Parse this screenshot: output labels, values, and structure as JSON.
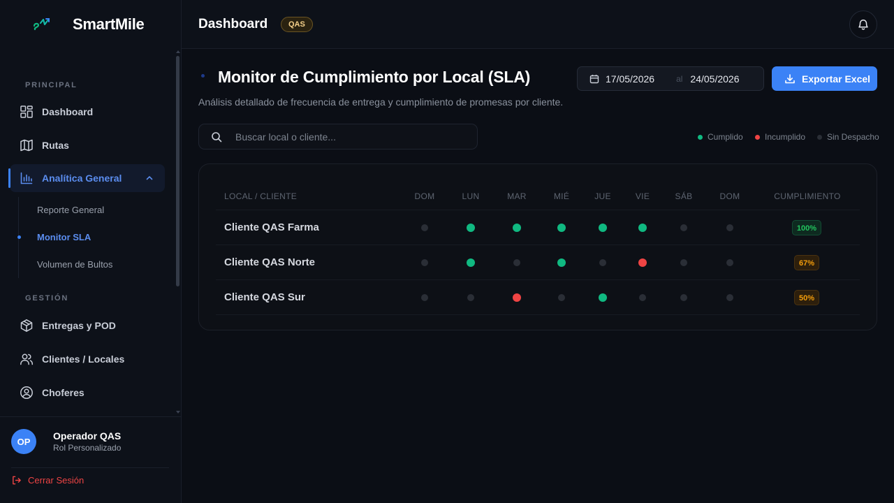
{
  "app": {
    "name": "SmartMile"
  },
  "sidebar": {
    "sections": {
      "principal": "PRINCIPAL",
      "gestion": "GESTIÓN"
    },
    "items": {
      "dashboard": "Dashboard",
      "rutas": "Rutas",
      "analitica": "Analítica General",
      "entregas": "Entregas y POD",
      "clientes": "Clientes / Locales",
      "choferes": "Choferes"
    },
    "subitems": {
      "reporte": "Reporte General",
      "monitor": "Monitor SLA",
      "volumen": "Volumen de Bultos"
    }
  },
  "user": {
    "initials": "OP",
    "name": "Operador QAS",
    "role": "Rol Personalizado",
    "logout": "Cerrar Sesión"
  },
  "header": {
    "title": "Dashboard",
    "env": "QAS"
  },
  "main": {
    "title": "Monitor de Cumplimiento por Local (SLA)",
    "subtitle": "Análisis detallado de frecuencia de entrega y cumplimiento de promesas por cliente.",
    "date_from": "17/05/2026",
    "date_sep": "al",
    "date_to": "24/05/2026",
    "export_label": "Exportar Excel",
    "search_placeholder": "Buscar local o cliente...",
    "legend": {
      "cumplido": "Cumplido",
      "incumplido": "Incumplido",
      "sin_despacho": "Sin Despacho"
    }
  },
  "colors": {
    "cumplido": "#10b981",
    "incumplido": "#ef4444",
    "sin": "#2a2e36",
    "accent": "#3b82f6"
  },
  "table": {
    "header_local": "LOCAL / CLIENTE",
    "days": [
      "DOM",
      "LUN",
      "MAR",
      "MIÉ",
      "JUE",
      "VIE",
      "SÁB",
      "DOM"
    ],
    "header_cumplimiento": "CUMPLIMIENTO",
    "rows": [
      {
        "name": "Cliente QAS Farma",
        "status": [
          "none",
          "ok",
          "ok",
          "ok",
          "ok",
          "ok",
          "none",
          "none"
        ],
        "pct": "100%",
        "level": "high"
      },
      {
        "name": "Cliente QAS Norte",
        "status": [
          "none",
          "ok",
          "none",
          "ok",
          "none",
          "fail",
          "none",
          "none"
        ],
        "pct": "67%",
        "level": "mid"
      },
      {
        "name": "Cliente QAS Sur",
        "status": [
          "none",
          "none",
          "fail",
          "none",
          "ok",
          "none",
          "none",
          "none"
        ],
        "pct": "50%",
        "level": "mid"
      }
    ]
  }
}
